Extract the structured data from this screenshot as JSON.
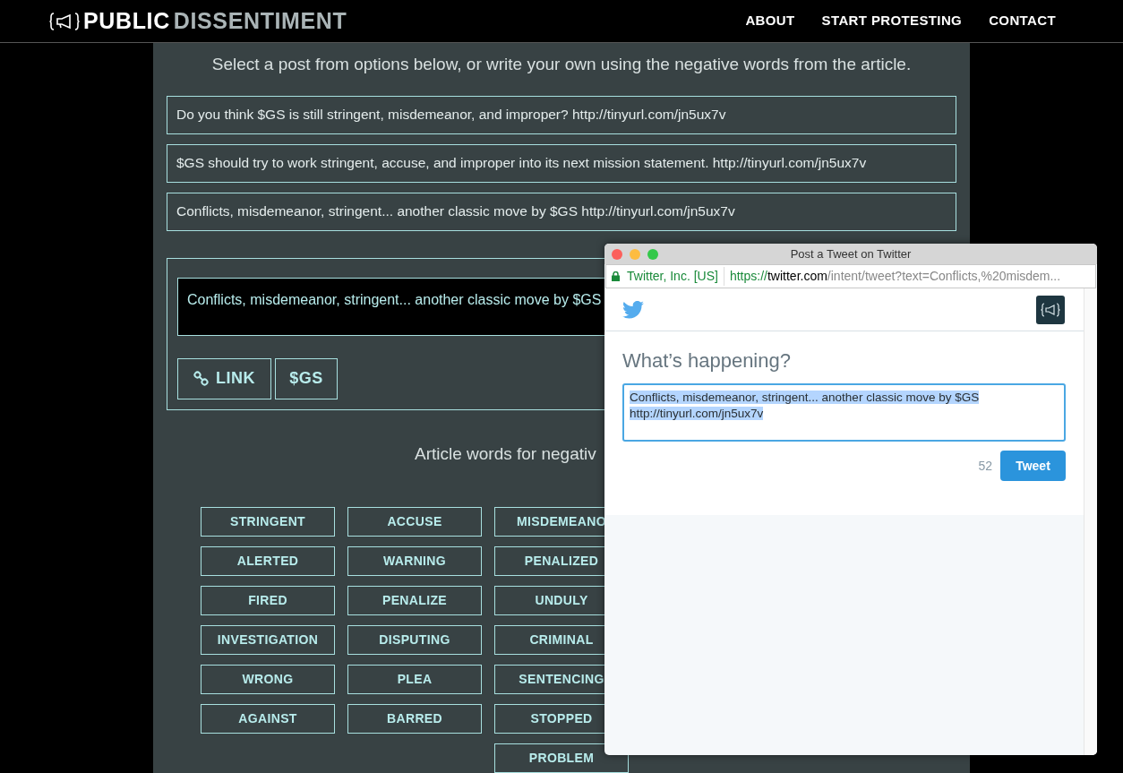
{
  "site": {
    "logo_left": "PUBLIC",
    "logo_right": "DISSENTIMENT",
    "nav": [
      {
        "label": "ABOUT"
      },
      {
        "label": "START PROTESTING"
      },
      {
        "label": "CONTACT"
      }
    ]
  },
  "intro": "Select a post from options below, or write your own using the negative words from the article.",
  "options": [
    "Do you think $GS is still stringent, misdemeanor, and improper? http://tinyurl.com/jn5ux7v",
    "$GS should try to work stringent, accuse, and improper into its next mission statement. http://tinyurl.com/jn5ux7v",
    "Conflicts, misdemeanor, stringent... another classic move by $GS http://tinyurl.com/jn5ux7v"
  ],
  "compose": {
    "value": "Conflicts, misdemeanor, stringent... another classic move by $GS",
    "buttons": [
      {
        "label": "LINK",
        "kind": "link"
      },
      {
        "label": "$GS",
        "kind": "ticker"
      }
    ]
  },
  "words_heading": "Article words for negativ",
  "word_columns": [
    [
      "STRINGENT",
      "ALERTED",
      "FIRED",
      "INVESTIGATION",
      "WRONG",
      "AGAINST"
    ],
    [
      "ACCUSE",
      "WARNING",
      "PENALIZE",
      "DISPUTING",
      "PLEA",
      "BARRED"
    ],
    [
      "MISDEMEANO",
      "PENALIZED",
      "UNDULY",
      "CRIMINAL",
      "SENTENCING",
      "STOPPED",
      "PROBLEM"
    ]
  ],
  "popup": {
    "title": "Post a Tweet on Twitter",
    "cert": "Twitter, Inc. [US]",
    "url_scheme": "https://",
    "url_host": "twitter.com",
    "url_path": "/intent/tweet?text=Conflicts,%20misdem...",
    "heading": "What’s happening?",
    "tweet_text": "Conflicts, misdemeanor, stringent... another classic move by $GS\nhttp://tinyurl.com/jn5ux7v",
    "counter": "52",
    "button": "Tweet"
  }
}
